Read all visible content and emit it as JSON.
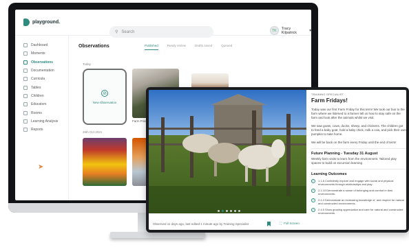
{
  "app": {
    "brand": "playground.",
    "search_placeholder": "Search",
    "user_name": "Tracy Kilpatrick",
    "user_initials": "TK"
  },
  "sidebar": {
    "items": [
      {
        "label": "Dashboard",
        "icon": "dashboard-icon"
      },
      {
        "label": "Moments",
        "icon": "moments-icon"
      },
      {
        "label": "Observations",
        "icon": "observations-icon",
        "active": true
      },
      {
        "label": "Documentation",
        "icon": "documentation-icon"
      },
      {
        "label": "Curricula",
        "icon": "curricula-icon"
      },
      {
        "label": "Tables",
        "icon": "tables-icon"
      },
      {
        "label": "Children",
        "icon": "children-icon"
      },
      {
        "label": "Educators",
        "icon": "educators-icon"
      },
      {
        "label": "Rooms",
        "icon": "rooms-icon"
      },
      {
        "label": "Learning Analysis",
        "icon": "learning-analysis-icon"
      },
      {
        "label": "Reports",
        "icon": "reports-icon"
      }
    ]
  },
  "observations": {
    "title": "Observations",
    "tabs": [
      "Published",
      "Ready review",
      "Drafts saved",
      "Queued"
    ],
    "date_today": "Today",
    "new_label": "New Observation",
    "first_caption": "Farm Fridays!",
    "date_older": "26th Oct 2021"
  },
  "detail": {
    "author_role": "TRAINING SPECIALIST",
    "title": "Farm Fridays!",
    "para1": "Today was our first Farm Friday for this term! We took our bus to the farm where we listened to a farmer tell us how to stay safe on the farm and look after the animals whilst we visit.",
    "para2": "We saw goats, cows, ducks, sheep, and chickens. The children got to feed a baby goat, hold a baby chick, milk a cow, and pick their own pumpkin to take home.",
    "para3": "We will be back on the farm every Friday until the end of term!",
    "future_heading": "Future Planning - Tuesday 31 August",
    "future_text": "Weekly farm visits to learn from the environment. Tailored play spaces to build on excursion learning",
    "outcomes_heading": "Learning Outcomes",
    "outcomes": [
      "1.1.8 Confidently explore and engage with social and physical environments through relationships and play.",
      "2.1.10 Demonstrate a sense of belonging and comfort in their environments.",
      "2.4.3 Demonstrate an increasing knowledge of, and respect for natural and constructed environments.",
      "2.4.5 Show growing appreciation and care for natural and constructed environments."
    ],
    "footer_meta": "Observed 11 days ago, last edited 1 minute ago by Training Specialist",
    "fullscreen_label": "Full Screen",
    "carousel": {
      "count": 6,
      "active_index": 1
    }
  }
}
